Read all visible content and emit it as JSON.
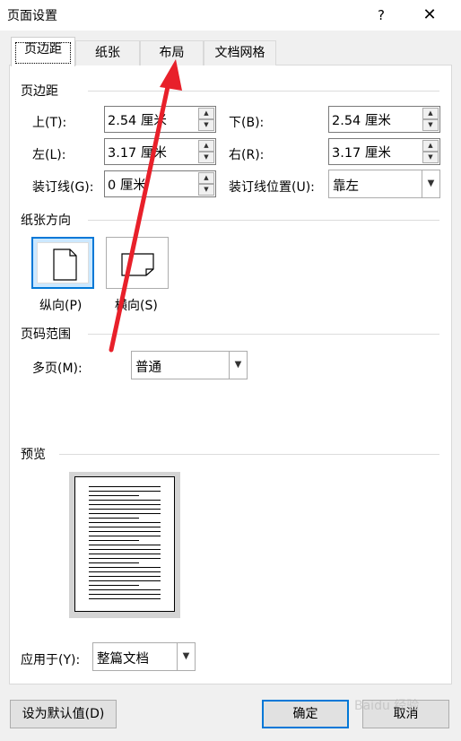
{
  "window": {
    "title": "页面设置",
    "help": "?",
    "close": "✕"
  },
  "tabs": [
    {
      "label": "页边距",
      "active": true
    },
    {
      "label": "纸张",
      "active": false
    },
    {
      "label": "布局",
      "active": false
    },
    {
      "label": "文档网格",
      "active": false
    }
  ],
  "margins": {
    "section": "页边距",
    "top": {
      "label": "上(T):",
      "value": "2.54 厘米"
    },
    "bottom": {
      "label": "下(B):",
      "value": "2.54 厘米"
    },
    "left": {
      "label": "左(L):",
      "value": "3.17 厘米"
    },
    "right": {
      "label": "右(R):",
      "value": "3.17 厘米"
    },
    "gutter": {
      "label": "装订线(G):",
      "value": "0 厘米"
    },
    "gutter_pos": {
      "label": "装订线位置(U):",
      "value": "靠左"
    }
  },
  "orientation": {
    "section": "纸张方向",
    "portrait": "纵向(P)",
    "landscape": "横向(S)",
    "selected": "portrait"
  },
  "pages": {
    "section": "页码范围",
    "multiple_label": "多页(M):",
    "multiple_value": "普通"
  },
  "preview": {
    "section": "预览",
    "apply_label": "应用于(Y):",
    "apply_value": "整篇文档"
  },
  "buttons": {
    "set_default": "设为默认值(D)",
    "ok": "确定",
    "cancel": "取消"
  },
  "watermark": "Baidu 经验",
  "colors": {
    "accent": "#0078d7",
    "annotation_arrow": "#e8202a"
  }
}
